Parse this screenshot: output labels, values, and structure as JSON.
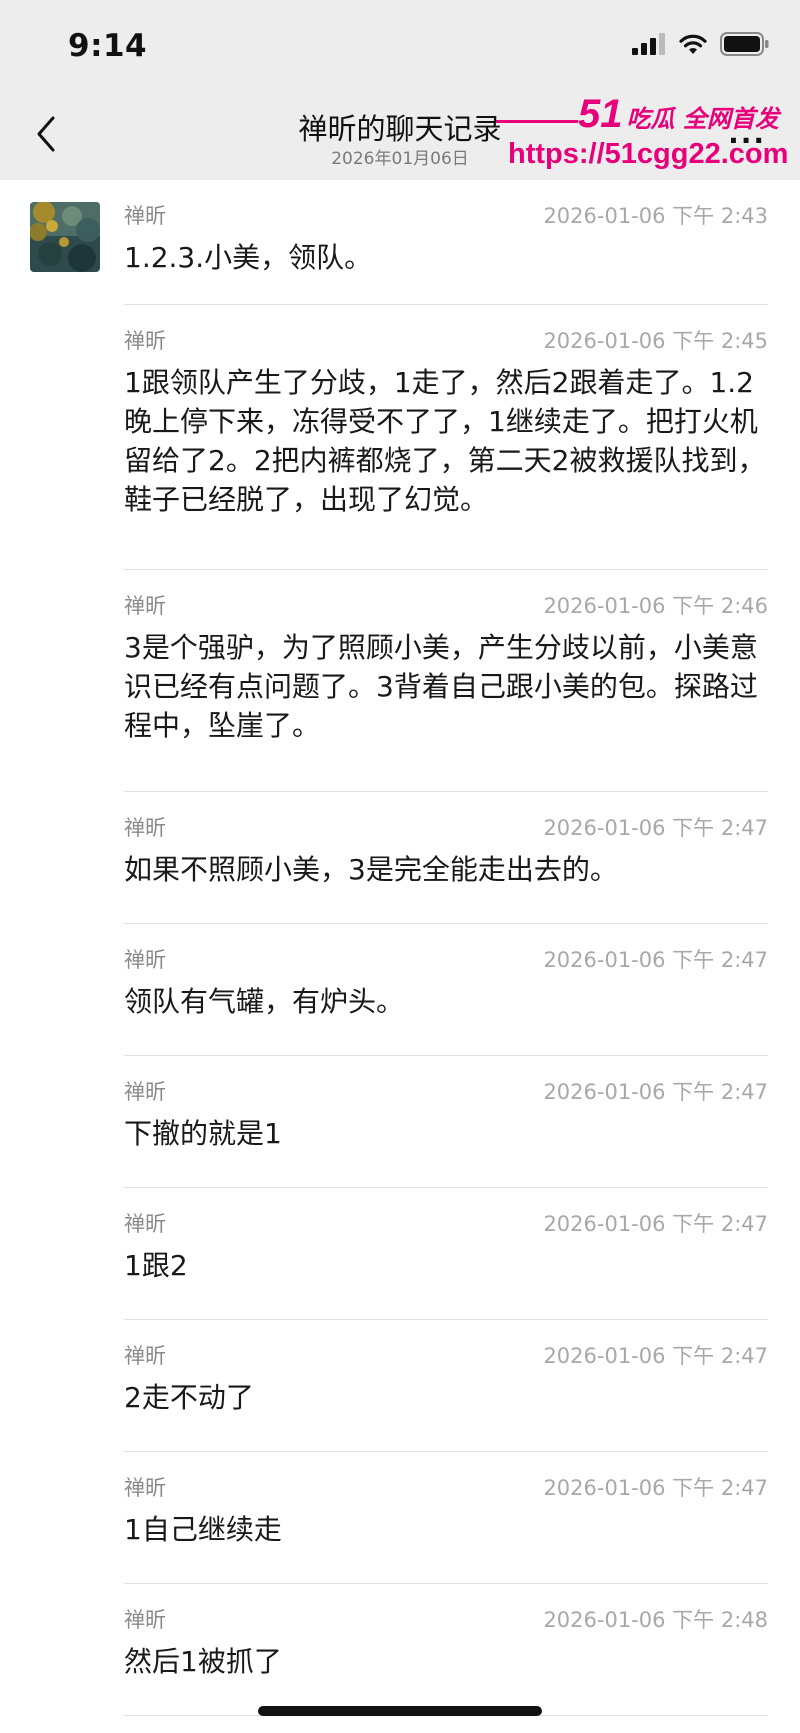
{
  "status_bar": {
    "time": "9:14"
  },
  "nav": {
    "title": "禅昕的聊天记录",
    "subtitle": "2026年01月06日",
    "more": "···"
  },
  "watermark": {
    "brand_num": "51",
    "brand_text": "吃瓜 全网首发",
    "url": "https://51cgg22.com"
  },
  "messages": [
    {
      "name": "禅昕",
      "time": "2026-01-06 下午 2:43",
      "text": "1.2.3.小美，领队。"
    },
    {
      "name": "禅昕",
      "time": "2026-01-06 下午 2:45",
      "text": "1跟领队产生了分歧，1走了，然后2跟着走了。1.2晚上停下来，冻得受不了了，1继续走了。把打火机留给了2。2把内裤都烧了，第二天2被救援队找到，鞋子已经脱了，出现了幻觉。"
    },
    {
      "name": "禅昕",
      "time": "2026-01-06 下午 2:46",
      "text": "3是个强驴，为了照顾小美，产生分歧以前，小美意识已经有点问题了。3背着自己跟小美的包。探路过程中，坠崖了。"
    },
    {
      "name": "禅昕",
      "time": "2026-01-06 下午 2:47",
      "text": "如果不照顾小美，3是完全能走出去的。"
    },
    {
      "name": "禅昕",
      "time": "2026-01-06 下午 2:47",
      "text": "领队有气罐，有炉头。"
    },
    {
      "name": "禅昕",
      "time": "2026-01-06 下午 2:47",
      "text": "下撤的就是1"
    },
    {
      "name": "禅昕",
      "time": "2026-01-06 下午 2:47",
      "text": "1跟2"
    },
    {
      "name": "禅昕",
      "time": "2026-01-06 下午 2:47",
      "text": "2走不动了"
    },
    {
      "name": "禅昕",
      "time": "2026-01-06 下午 2:47",
      "text": "1自己继续走"
    },
    {
      "name": "禅昕",
      "time": "2026-01-06 下午 2:48",
      "text": "然后1被抓了"
    }
  ],
  "colors": {
    "accent": "#e8007a",
    "nav_bg": "#ededed",
    "meta_text": "#a8a8a8"
  }
}
